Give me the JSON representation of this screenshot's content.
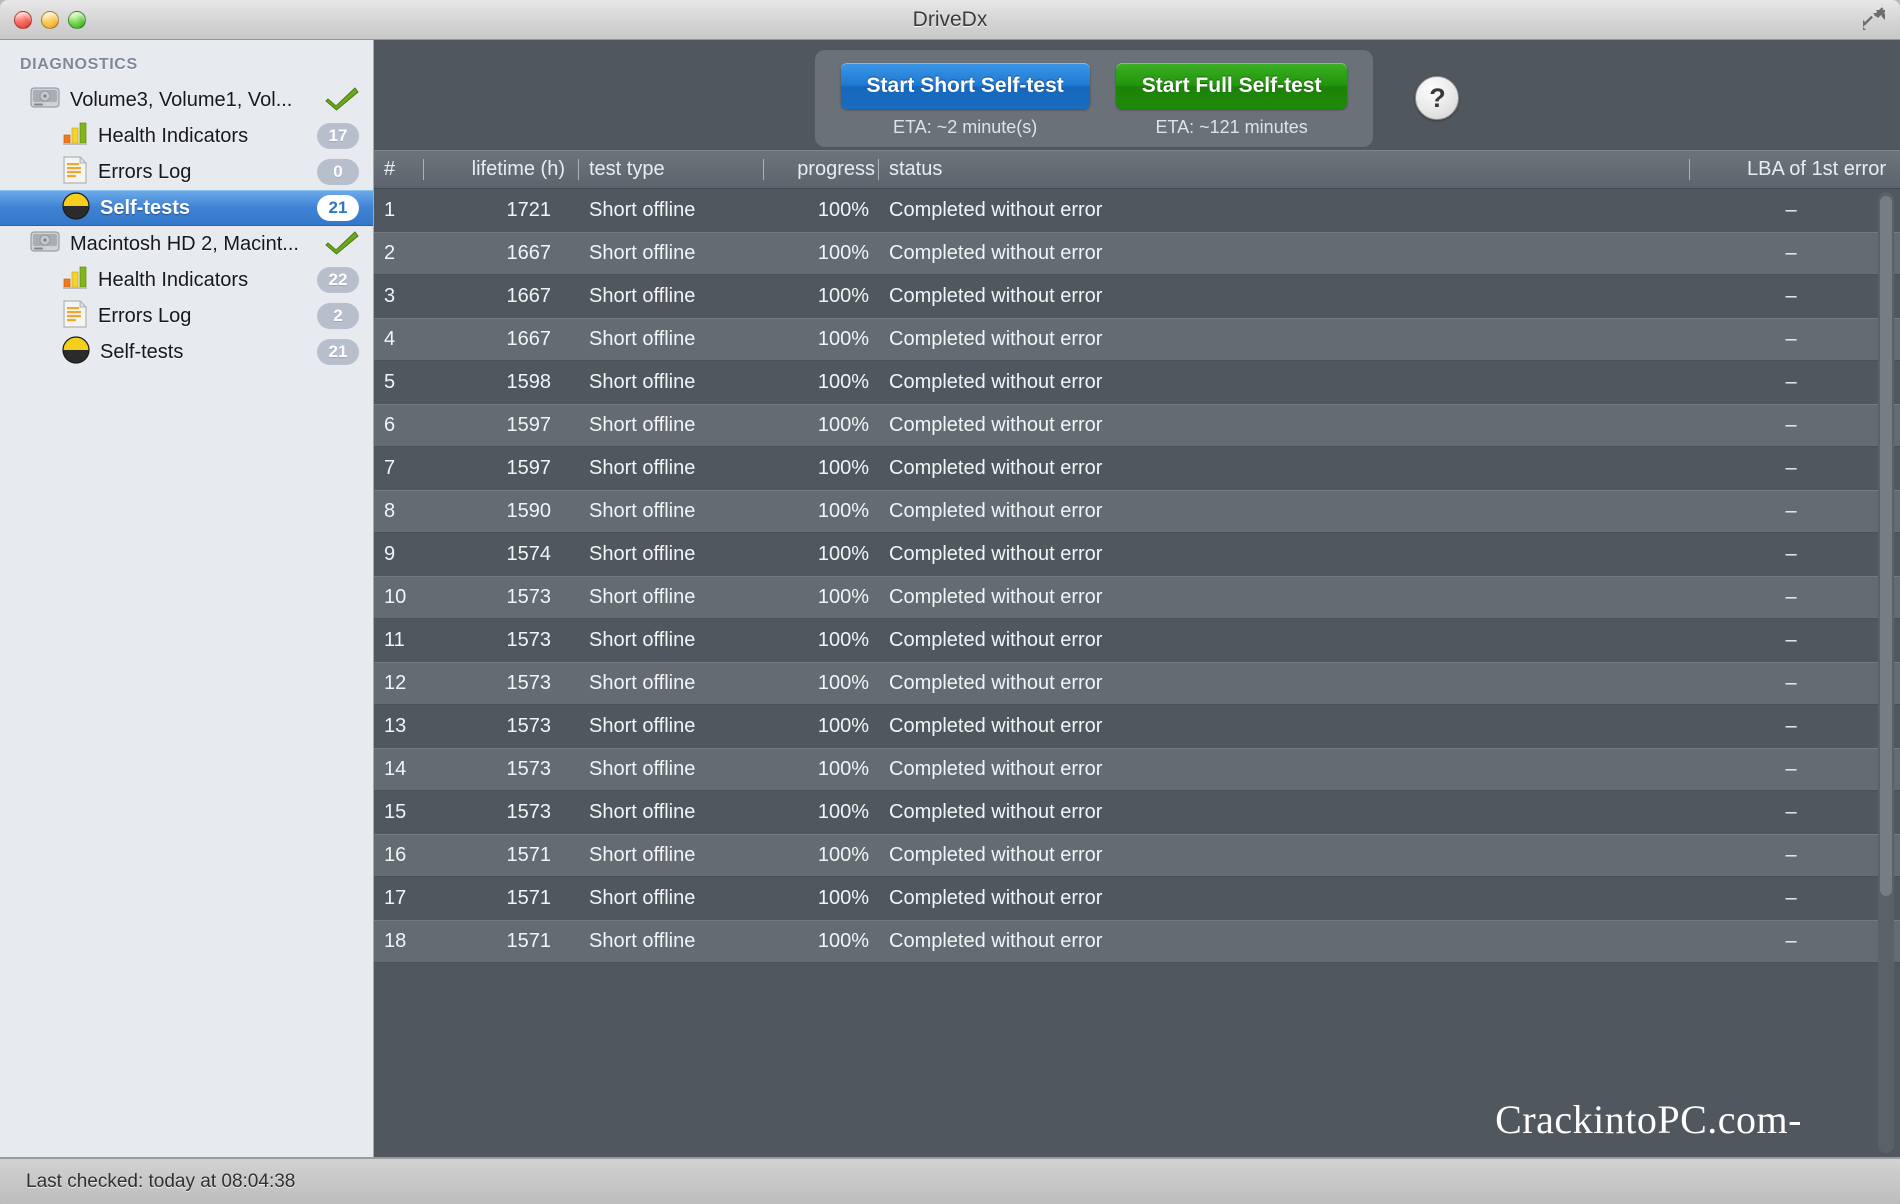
{
  "window": {
    "title": "DriveDx",
    "traffic_lights": [
      "close",
      "minimize",
      "zoom"
    ],
    "fullscreen_icon": "fullscreen-expand-icon"
  },
  "sidebar": {
    "header": "DIAGNOSTICS",
    "items": [
      {
        "label": "Volume3, Volume1, Vol...",
        "icon": "hard-drive-icon",
        "level": "drive",
        "status": "ok-check",
        "badge": null,
        "selected": false
      },
      {
        "label": "Health Indicators",
        "icon": "bar-chart-icon",
        "level": "child",
        "status": null,
        "badge": "17",
        "selected": false
      },
      {
        "label": "Errors Log",
        "icon": "document-lines-icon",
        "level": "child",
        "status": null,
        "badge": "0",
        "selected": false
      },
      {
        "label": "Self-tests",
        "icon": "pie-chart-icon",
        "level": "child",
        "status": null,
        "badge": "21",
        "selected": true
      },
      {
        "label": "Macintosh HD 2, Macint...",
        "icon": "hard-drive-icon",
        "level": "drive",
        "status": "ok-check",
        "badge": null,
        "selected": false
      },
      {
        "label": "Health Indicators",
        "icon": "bar-chart-icon",
        "level": "child",
        "status": null,
        "badge": "22",
        "selected": false
      },
      {
        "label": "Errors Log",
        "icon": "document-lines-icon",
        "level": "child",
        "status": null,
        "badge": "2",
        "selected": false
      },
      {
        "label": "Self-tests",
        "icon": "pie-chart-icon",
        "level": "child",
        "status": null,
        "badge": "21",
        "selected": false
      }
    ]
  },
  "toolbar": {
    "short_test_label": "Start Short Self-test",
    "short_test_eta": "ETA: ~2 minute(s)",
    "full_test_label": "Start Full Self-test",
    "full_test_eta": "ETA: ~121 minutes",
    "help_label": "?",
    "colors": {
      "short_test": "#1f7ad4",
      "full_test": "#21960c"
    }
  },
  "table": {
    "columns": [
      "#",
      "lifetime (h)",
      "test type",
      "progress",
      "status",
      "LBA of 1st error"
    ],
    "rows": [
      {
        "num": "1",
        "lifetime": "1721",
        "type": "Short offline",
        "progress": "100%",
        "status": "Completed without error",
        "lba": "–"
      },
      {
        "num": "2",
        "lifetime": "1667",
        "type": "Short offline",
        "progress": "100%",
        "status": "Completed without error",
        "lba": "–"
      },
      {
        "num": "3",
        "lifetime": "1667",
        "type": "Short offline",
        "progress": "100%",
        "status": "Completed without error",
        "lba": "–"
      },
      {
        "num": "4",
        "lifetime": "1667",
        "type": "Short offline",
        "progress": "100%",
        "status": "Completed without error",
        "lba": "–"
      },
      {
        "num": "5",
        "lifetime": "1598",
        "type": "Short offline",
        "progress": "100%",
        "status": "Completed without error",
        "lba": "–"
      },
      {
        "num": "6",
        "lifetime": "1597",
        "type": "Short offline",
        "progress": "100%",
        "status": "Completed without error",
        "lba": "–"
      },
      {
        "num": "7",
        "lifetime": "1597",
        "type": "Short offline",
        "progress": "100%",
        "status": "Completed without error",
        "lba": "–"
      },
      {
        "num": "8",
        "lifetime": "1590",
        "type": "Short offline",
        "progress": "100%",
        "status": "Completed without error",
        "lba": "–"
      },
      {
        "num": "9",
        "lifetime": "1574",
        "type": "Short offline",
        "progress": "100%",
        "status": "Completed without error",
        "lba": "–"
      },
      {
        "num": "10",
        "lifetime": "1573",
        "type": "Short offline",
        "progress": "100%",
        "status": "Completed without error",
        "lba": "–"
      },
      {
        "num": "11",
        "lifetime": "1573",
        "type": "Short offline",
        "progress": "100%",
        "status": "Completed without error",
        "lba": "–"
      },
      {
        "num": "12",
        "lifetime": "1573",
        "type": "Short offline",
        "progress": "100%",
        "status": "Completed without error",
        "lba": "–"
      },
      {
        "num": "13",
        "lifetime": "1573",
        "type": "Short offline",
        "progress": "100%",
        "status": "Completed without error",
        "lba": "–"
      },
      {
        "num": "14",
        "lifetime": "1573",
        "type": "Short offline",
        "progress": "100%",
        "status": "Completed without error",
        "lba": "–"
      },
      {
        "num": "15",
        "lifetime": "1573",
        "type": "Short offline",
        "progress": "100%",
        "status": "Completed without error",
        "lba": "–"
      },
      {
        "num": "16",
        "lifetime": "1571",
        "type": "Short offline",
        "progress": "100%",
        "status": "Completed without error",
        "lba": "–"
      },
      {
        "num": "17",
        "lifetime": "1571",
        "type": "Short offline",
        "progress": "100%",
        "status": "Completed without error",
        "lba": "–"
      },
      {
        "num": "18",
        "lifetime": "1571",
        "type": "Short offline",
        "progress": "100%",
        "status": "Completed without error",
        "lba": "–"
      }
    ]
  },
  "watermark": "CrackintoPC.com-",
  "statusbar": {
    "text": "Last checked: today at 08:04:38"
  }
}
